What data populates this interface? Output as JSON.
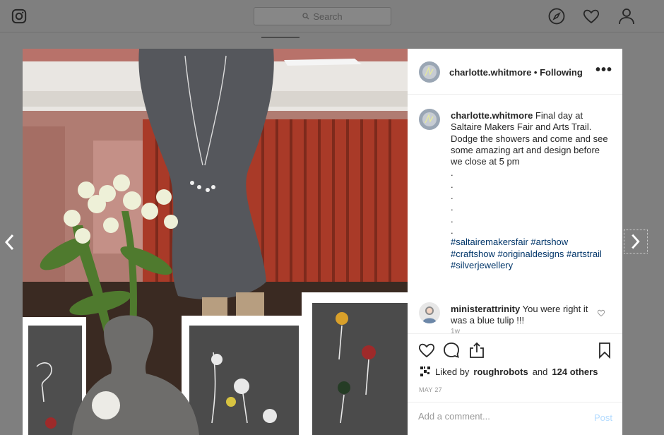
{
  "header": {
    "search_placeholder": "Search",
    "icons": [
      "instagram-logo-icon",
      "search-icon",
      "compass-icon",
      "heart-icon",
      "profile-icon"
    ]
  },
  "post": {
    "image_description_icon": "photo",
    "username": "charlotte.whitmore",
    "follow_status": "Following",
    "separator": "•",
    "more_label": "•••",
    "caption": {
      "username": "charlotte.whitmore",
      "text": "Final day at Saltaire Makers Fair and Arts Trail. Dodge the showers and come and see some amazing art and design before we close at 5 pm",
      "dots": [
        ".",
        ".",
        ".",
        ".",
        ".",
        "."
      ],
      "hashtags": "#saltairemakersfair #artshow #craftshow #originaldesigns #artstrail #silverjewellery",
      "time": "1w"
    },
    "comment": {
      "username": "ministerattrinity",
      "text": "You were right it was a blue tulip !!!"
    },
    "likes": {
      "prefix": "Liked by",
      "user": "roughrobots",
      "middle": "and",
      "others": "124 others"
    },
    "date": "MAY 27",
    "comment_placeholder": "Add a comment...",
    "post_label": "Post"
  },
  "colors": {
    "overlay": "#7f7f7f",
    "link": "#003569",
    "post_disabled": "#b3dbff",
    "muted": "#999999"
  }
}
